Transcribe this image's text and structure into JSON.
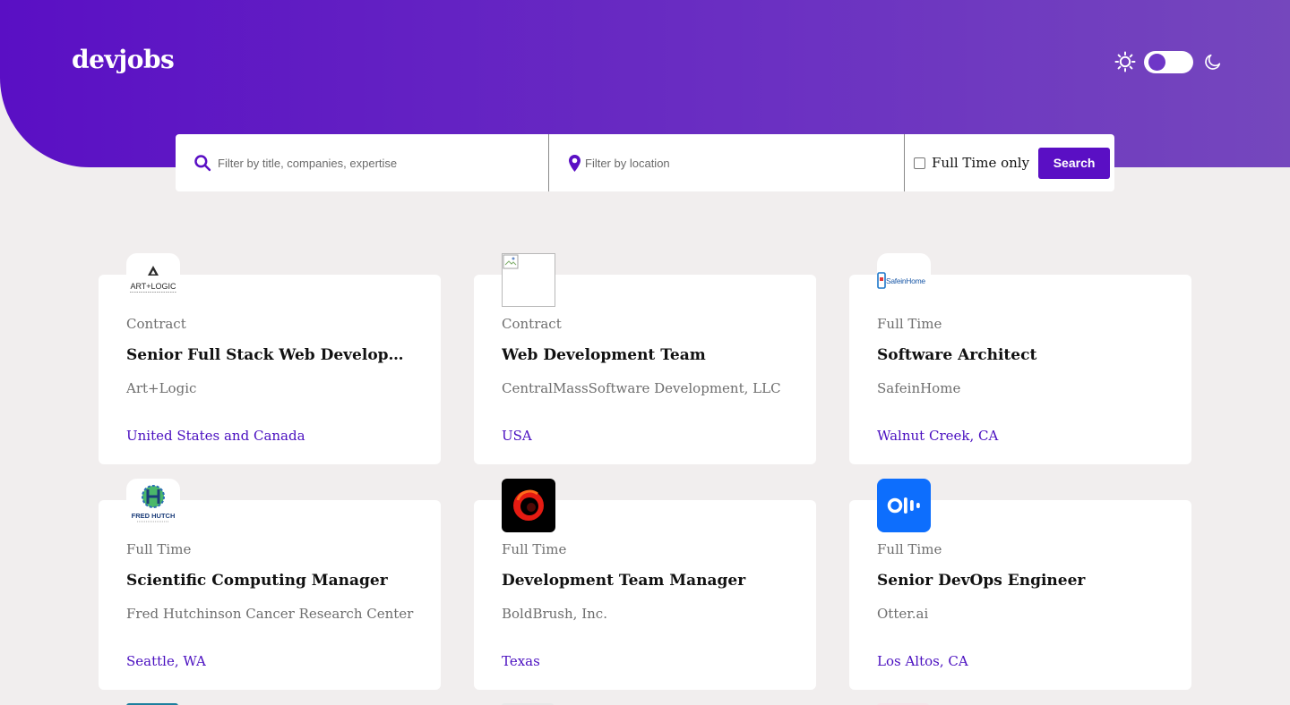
{
  "app": {
    "logo": "devjobs"
  },
  "theme": {
    "light_icon": "sun-icon",
    "dark_icon": "moon-icon",
    "mode": "light"
  },
  "search": {
    "title_placeholder": "Filter by title, companies, expertise",
    "location_placeholder": "Filter by location",
    "fulltime_label": "Full Time only",
    "fulltime_checked": false,
    "button_label": "Search"
  },
  "colors": {
    "accent": "#5a0fc4",
    "location": "#4a0fc0",
    "background": "#f1eeee"
  },
  "jobs": [
    {
      "type": "Contract",
      "title": "Senior Full Stack Web Developer (re…",
      "company": "Art+Logic",
      "location": "United States and Canada",
      "logo": "art-logic-logo",
      "logo_text": "ART+LOGIC"
    },
    {
      "type": "Contract",
      "title": "Web Development Team",
      "company": "CentralMassSoftware Development, LLC",
      "location": "USA",
      "logo": "broken-image-icon",
      "logo_text": ""
    },
    {
      "type": "Full Time",
      "title": "Software Architect",
      "company": "SafeinHome",
      "location": "Walnut Creek, CA",
      "logo": "safeinhome-logo",
      "logo_text": "SafeinHome"
    },
    {
      "type": "Full Time",
      "title": "Scientific Computing Manager",
      "company": "Fred Hutchinson Cancer Research Center",
      "location": "Seattle, WA",
      "logo": "fred-hutch-logo",
      "logo_text": "FRED HUTCH"
    },
    {
      "type": "Full Time",
      "title": "Development Team Manager",
      "company": "BoldBrush, Inc.",
      "location": "Texas",
      "logo": "boldbrush-logo",
      "logo_text": ""
    },
    {
      "type": "Full Time",
      "title": "Senior DevOps Engineer",
      "company": "Otter.ai",
      "location": "Los Altos, CA",
      "logo": "otter-ai-logo",
      "logo_text": ""
    }
  ]
}
